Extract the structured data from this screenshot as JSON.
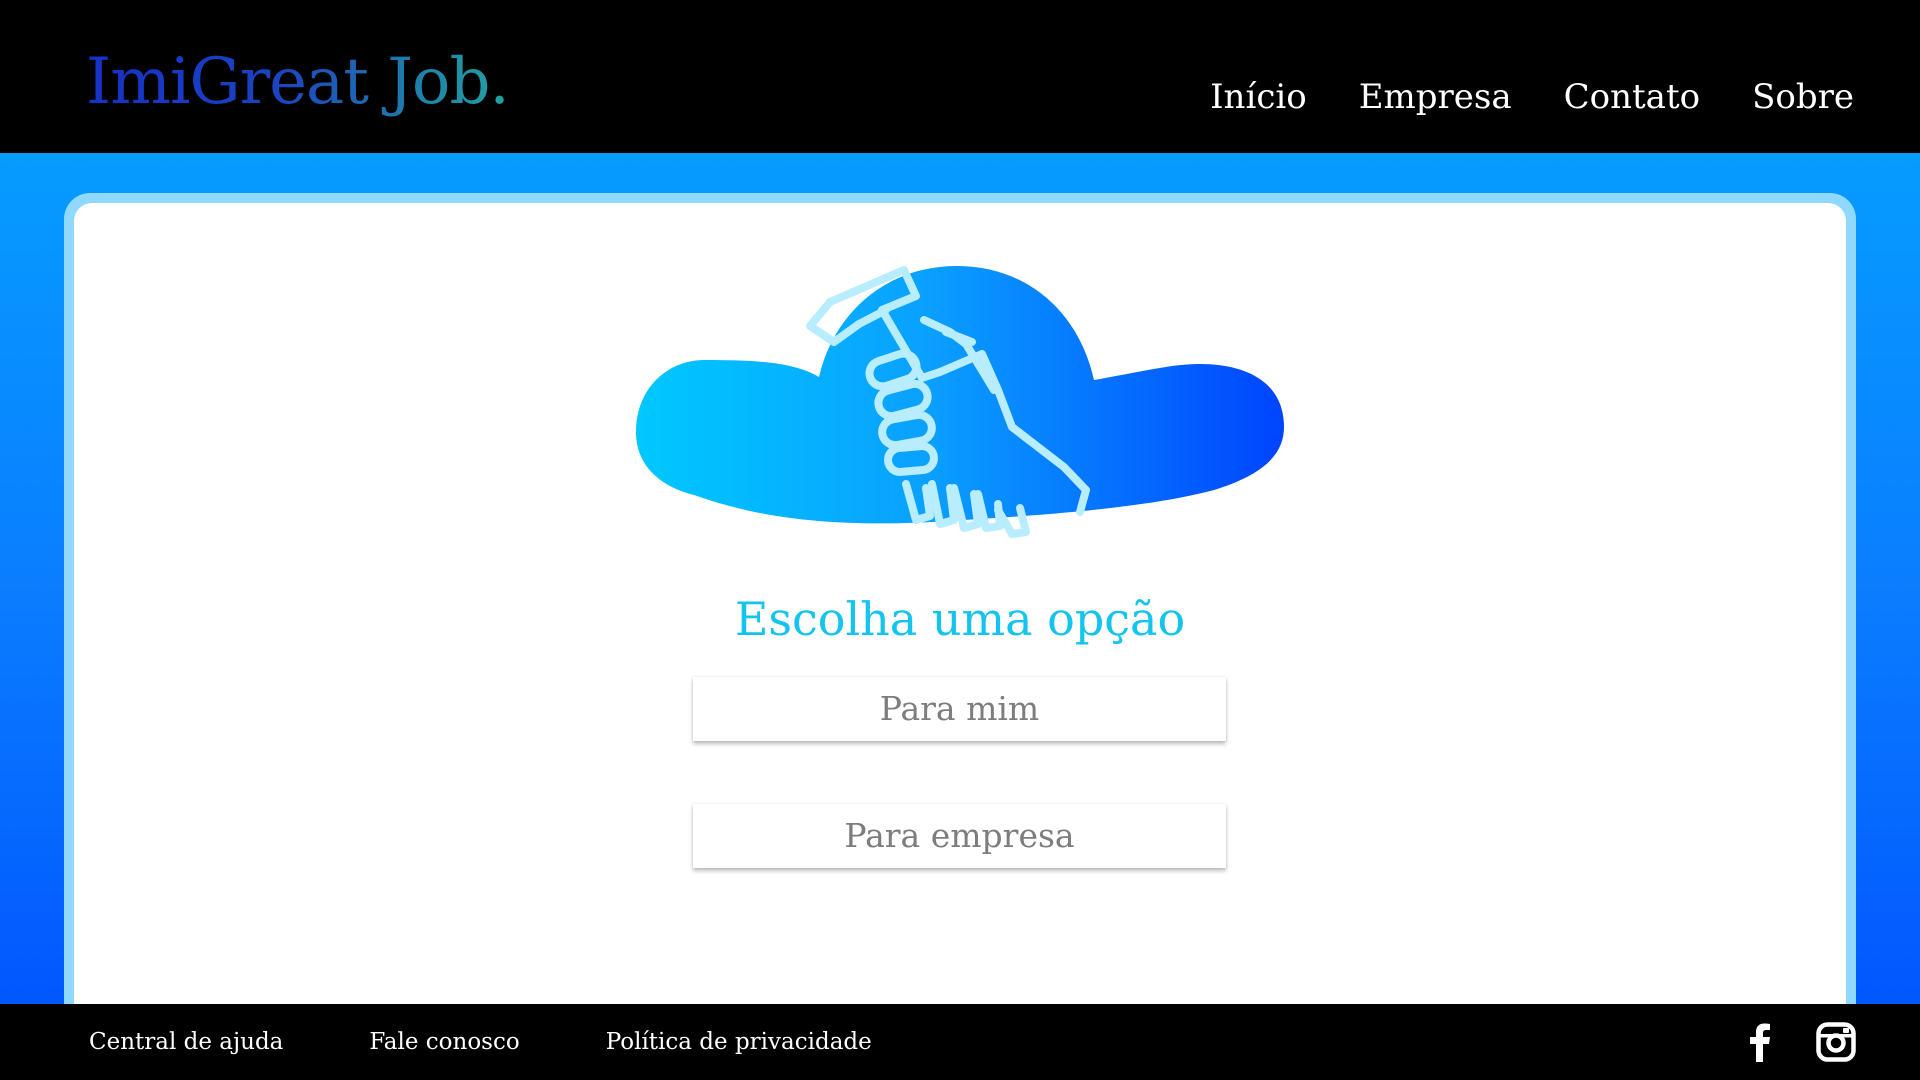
{
  "header": {
    "logo": "ImiGreat Job.",
    "nav": [
      "Início",
      "Empresa",
      "Contato",
      "Sobre"
    ]
  },
  "main": {
    "illustration": "cloud-handshake-icon",
    "heading": "Escolha uma opção",
    "options": [
      "Para mim",
      "Para empresa"
    ]
  },
  "footer": {
    "links": [
      "Central de ajuda",
      "Fale conosco",
      "Política de privacidade"
    ],
    "social": [
      "facebook-icon",
      "instagram-icon"
    ]
  },
  "colors": {
    "header_bg": "#000000",
    "page_gradient_top": "#05a6ff",
    "page_gradient_bottom": "#0050ff",
    "heading": "#12c4ee",
    "button_text": "#7d7d7d",
    "cloud_gradient_start": "#00c8ff",
    "cloud_gradient_end": "#0044ff"
  }
}
